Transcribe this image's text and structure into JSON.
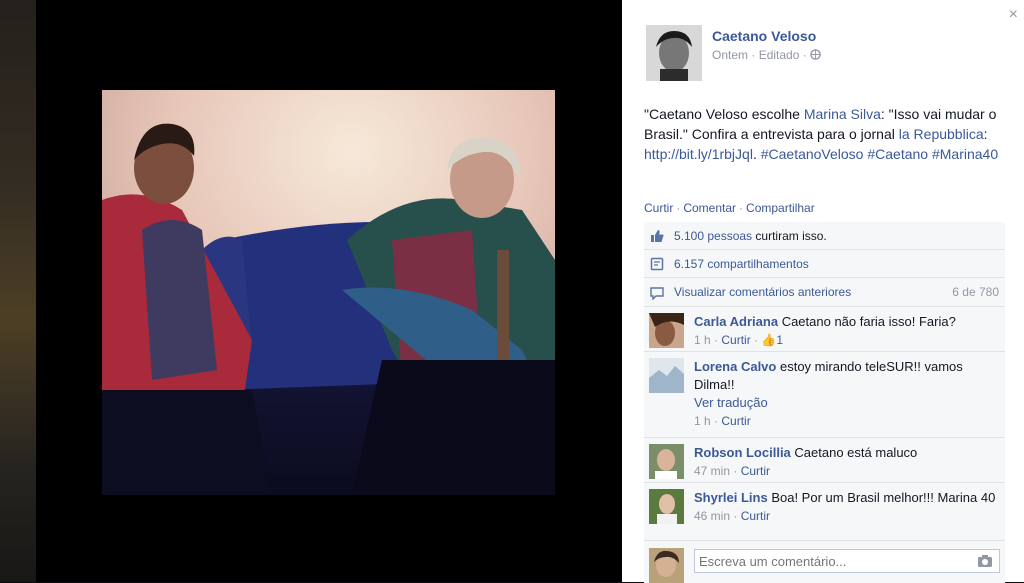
{
  "post": {
    "author": "Caetano Veloso",
    "time": "Ontem",
    "edited": "Editado",
    "text_1": "\"Caetano Veloso escolhe ",
    "mention_1": "Marina Silva",
    "text_2": ": \"Isso vai mudar o Brasil.\" Confira a entrevista para o jornal ",
    "mention_2": "la Repubblica",
    "text_3": ": ",
    "url": "http://bit.ly/1rbjJql",
    "text_4": ". ",
    "hashtags": "#CaetanoVeloso #Caetano #Marina40"
  },
  "actions": {
    "like": "Curtir",
    "comment": "Comentar",
    "share": "Compartilhar"
  },
  "ufi": {
    "likes_count": "5.100 pessoas",
    "likes_suffix": " curtiram isso.",
    "shares": "6.157 compartilhamentos",
    "view_previous": "Visualizar comentários anteriores",
    "pager": "6 de 780"
  },
  "comments": [
    {
      "name": "Carla Adriana",
      "text": "Caetano não faria isso! Faria?",
      "time": "1 h",
      "like": "Curtir",
      "likes": "1"
    },
    {
      "name": "Lorena Calvo",
      "text": "estoy mirando teleSUR!! vamos Dilma!!",
      "translate": "Ver tradução",
      "time": "1 h",
      "like": "Curtir"
    },
    {
      "name": "Robson Locillia",
      "text": "Caetano está maluco",
      "time": "47 min",
      "like": "Curtir"
    },
    {
      "name": "Shyrlei Lins",
      "text": "Boa! Por um Brasil melhor!!! Marina 40",
      "time": "46 min",
      "like": "Curtir"
    }
  ],
  "composer": {
    "placeholder": "Escreva um comentário..."
  },
  "close": "×"
}
